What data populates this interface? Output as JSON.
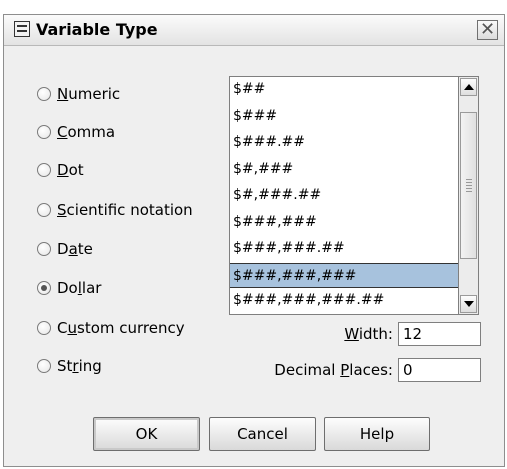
{
  "dialog": {
    "title": "Variable Type",
    "icons": {
      "app": "dialog-icon",
      "close": "close-icon"
    }
  },
  "types": [
    {
      "pre": "",
      "mn": "N",
      "post": "umeric",
      "checked": false
    },
    {
      "pre": "",
      "mn": "C",
      "post": "omma",
      "checked": false
    },
    {
      "pre": "",
      "mn": "D",
      "post": "ot",
      "checked": false
    },
    {
      "pre": "",
      "mn": "S",
      "post": "cientific notation",
      "checked": false
    },
    {
      "pre": "D",
      "mn": "a",
      "post": "te",
      "checked": false
    },
    {
      "pre": "Do",
      "mn": "l",
      "post": "lar",
      "checked": true
    },
    {
      "pre": "C",
      "mn": "u",
      "post": "stom currency",
      "checked": false
    },
    {
      "pre": "St",
      "mn": "r",
      "post": "ing",
      "checked": false
    }
  ],
  "formats": {
    "items": [
      "$##",
      "$###",
      "$###.##",
      "$#,###",
      "$#,###.##",
      "$###,###",
      "$###,###.##",
      "$###,###,###",
      "$###,###,###.##"
    ],
    "selected": "$###,###,###"
  },
  "width": {
    "pre": "",
    "mn": "W",
    "post": "idth:",
    "value": "12"
  },
  "decimal_places": {
    "pre": "Decimal ",
    "mn": "P",
    "post": "laces:",
    "value": "0"
  },
  "buttons": {
    "ok": "OK",
    "cancel": "Cancel",
    "help": "Help"
  }
}
